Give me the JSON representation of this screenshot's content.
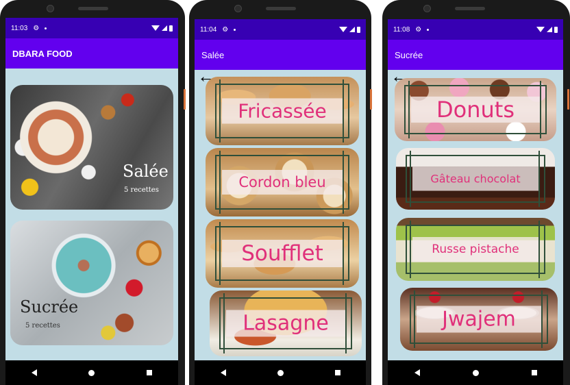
{
  "phones": [
    {
      "status": {
        "time": "11:03"
      },
      "appbar_title": "DBARA FOOD",
      "categories": [
        {
          "title": "Salée",
          "subtitle": "5 recettes"
        },
        {
          "title": "Sucrée",
          "subtitle": "5 recettes"
        }
      ]
    },
    {
      "status": {
        "time": "11:04"
      },
      "appbar_title": "Salée",
      "recipes": [
        "Fricassée",
        "Cordon bleu",
        "Soufflet",
        "Lasagne"
      ]
    },
    {
      "status": {
        "time": "11:08"
      },
      "appbar_title": "Sucrée",
      "recipes": [
        "Donuts",
        "Gâteau chocolat",
        "Russe pistache",
        "Jwajem"
      ]
    }
  ],
  "icons": {
    "back": "←",
    "settings": "⚙",
    "wifi": "wifi-icon",
    "signal": "signal-icon",
    "battery": "battery-icon"
  },
  "colors": {
    "statusbar": "#3700b3",
    "appbar": "#6200ee",
    "background": "#c2dde6",
    "recipe_text": "#e0307a"
  }
}
